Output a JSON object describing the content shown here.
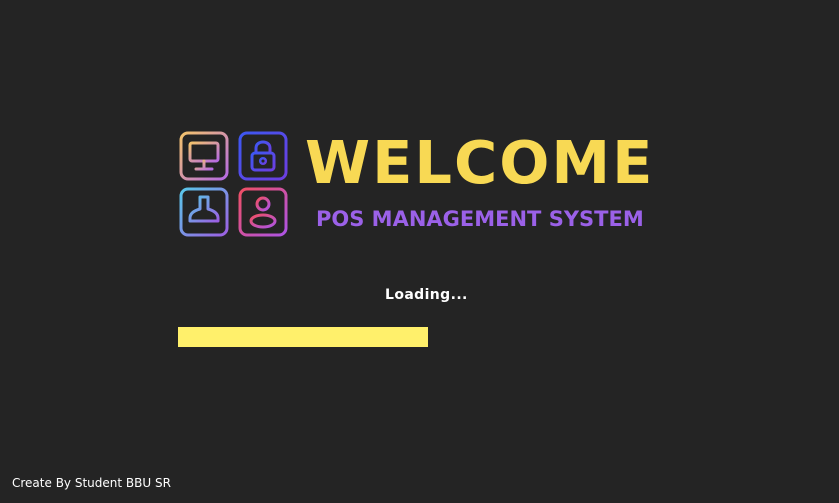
{
  "splash": {
    "title": "WELCOME",
    "subtitle": "POS MANAGEMENT SYSTEM",
    "loading_label": "Loading...",
    "progress_fraction": 0.5,
    "footer_credit": "Create By Student BBU SR"
  },
  "logo": {
    "icons": [
      "monitor-icon",
      "lock-icon",
      "stamp-icon",
      "user-icon"
    ]
  },
  "colors": {
    "background": "#242424",
    "title": "#f8d954",
    "subtitle": "#9b61e8",
    "progress_fill": "#fff06b",
    "monitor_gradient": [
      "#f3c36c",
      "#b56ae3"
    ],
    "lock_gradient": [
      "#3d58f2",
      "#6d3ee0"
    ],
    "stamp_gradient": [
      "#59c7e8",
      "#9c5fe3"
    ],
    "user_gradient": [
      "#f04f64",
      "#ad54e5"
    ]
  }
}
